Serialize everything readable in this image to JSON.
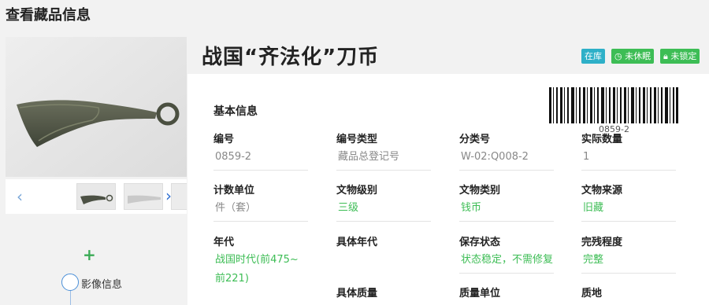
{
  "page": {
    "title": "查看藏品信息"
  },
  "object": {
    "title": "战国“齐法化”刀币"
  },
  "badges": {
    "status": "在库",
    "dormant": "未休眠",
    "locked": "未锁定"
  },
  "section": {
    "title": "基本信息"
  },
  "barcode": {
    "text": "0859-2"
  },
  "sidebar": {
    "image_info_label": "影像信息"
  },
  "fields": {
    "bianhao": {
      "label": "编号",
      "value": "0859-2"
    },
    "bianhao_type": {
      "label": "编号类型",
      "value": "藏品总登记号"
    },
    "fenleihao": {
      "label": "分类号",
      "value": "W-02:Q008-2"
    },
    "shiji_shuliang": {
      "label": "实际数量",
      "value": "1"
    },
    "jishu_danwei": {
      "label": "计数单位",
      "value": "件（套）"
    },
    "wenwu_jibie": {
      "label": "文物级别",
      "value": "三级"
    },
    "wenwu_leibie": {
      "label": "文物类别",
      "value": "钱币"
    },
    "wenwu_laiyuan": {
      "label": "文物来源",
      "value": "旧藏"
    },
    "niandai": {
      "label": "年代",
      "value": "战国时代(前475~前221)"
    },
    "juti_niandai": {
      "label": "具体年代",
      "value": ""
    },
    "baocun_zhuangtai": {
      "label": "保存状态",
      "value": "状态稳定，不需修复"
    },
    "wancan_chengdu": {
      "label": "完残程度",
      "value": "完整"
    },
    "juti_zhiliang": {
      "label": "具体质量",
      "value": ""
    },
    "zhiliang_danwei": {
      "label": "质量单位",
      "value": ""
    },
    "zhidi": {
      "label": "质地",
      "value": ""
    }
  },
  "colors": {
    "accent_green": "#3dbd55",
    "badge_blue": "#2eb0c8",
    "nav_blue": "#2f6fd1"
  },
  "icons": [
    "chevron-left-icon",
    "chevron-right-icon",
    "plus-icon",
    "clock-icon",
    "lock-icon",
    "barcode"
  ]
}
